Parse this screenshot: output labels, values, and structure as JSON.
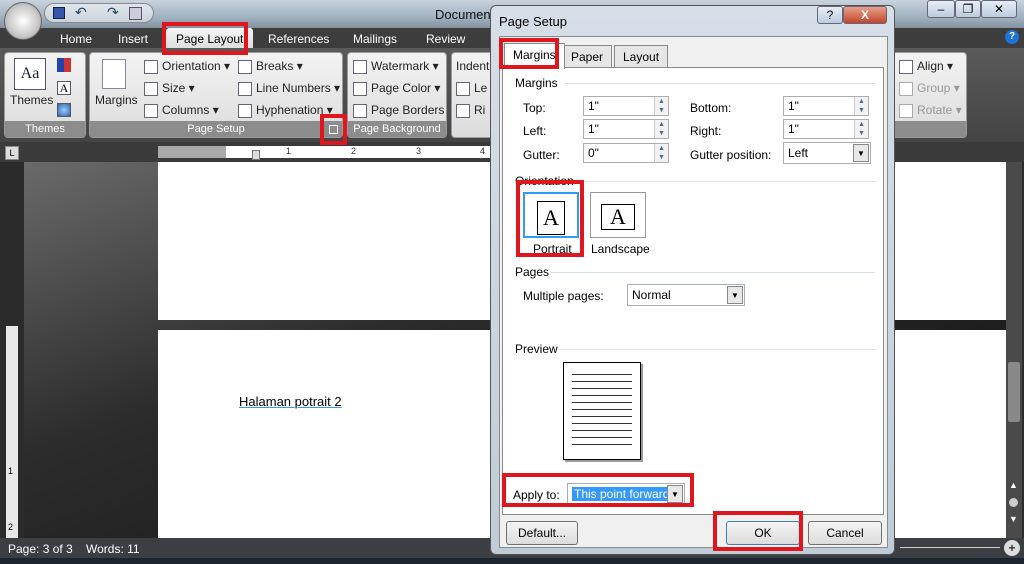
{
  "window": {
    "title": "Document"
  },
  "quick_access": [
    "save-icon",
    "undo-icon",
    "redo-icon",
    "print-preview-icon"
  ],
  "ribbon_tabs": [
    "Home",
    "Insert",
    "Page Layout",
    "References",
    "Mailings",
    "Review"
  ],
  "themes_group": {
    "label": "Themes",
    "themes_button": "Themes"
  },
  "page_setup_group": {
    "label": "Page Setup",
    "margins": "Margins",
    "orientation": "Orientation",
    "size": "Size",
    "columns": "Columns",
    "breaks": "Breaks",
    "line_numbers": "Line Numbers",
    "hyphenation": "Hyphenation"
  },
  "page_background_group": {
    "label": "Page Background",
    "watermark": "Watermark",
    "page_color": "Page Color",
    "page_borders": "Page Borders"
  },
  "paragraph_group": {
    "indent": "Indent",
    "left": "Le",
    "right": "Ri"
  },
  "arrange_group": {
    "align": "Align",
    "group": "Group",
    "rotate": "Rotate"
  },
  "ruler": {
    "ticks": [
      "1",
      "2",
      "3",
      "4"
    ]
  },
  "vruler": {
    "ticks": [
      "1",
      "2"
    ]
  },
  "document": {
    "text": "Halaman potrait 2"
  },
  "status": {
    "page": "Page: 3 of 3",
    "words": "Words: 11"
  },
  "dialog": {
    "title": "Page Setup",
    "help": "?",
    "close": "X",
    "tabs": [
      "Margins",
      "Paper",
      "Layout"
    ],
    "margins_section": "Margins",
    "top_label": "Top:",
    "top": "1\"",
    "bottom_label": "Bottom:",
    "bottom": "1\"",
    "left_label": "Left:",
    "left": "1\"",
    "right_label": "Right:",
    "right": "1\"",
    "gutter_label": "Gutter:",
    "gutter": "0\"",
    "gutter_pos_label": "Gutter position:",
    "gutter_pos": "Left",
    "orientation_section": "Orientation",
    "portrait": "Portrait",
    "landscape": "Landscape",
    "pages_section": "Pages",
    "multiple_pages_label": "Multiple pages:",
    "multiple_pages": "Normal",
    "preview_section": "Preview",
    "apply_to_label": "Apply to:",
    "apply_to": "This point forward",
    "default_button": "Default...",
    "ok_button": "OK",
    "cancel_button": "Cancel"
  },
  "colors": {
    "highlight": "#e0161e",
    "accent": "#3399ff"
  }
}
